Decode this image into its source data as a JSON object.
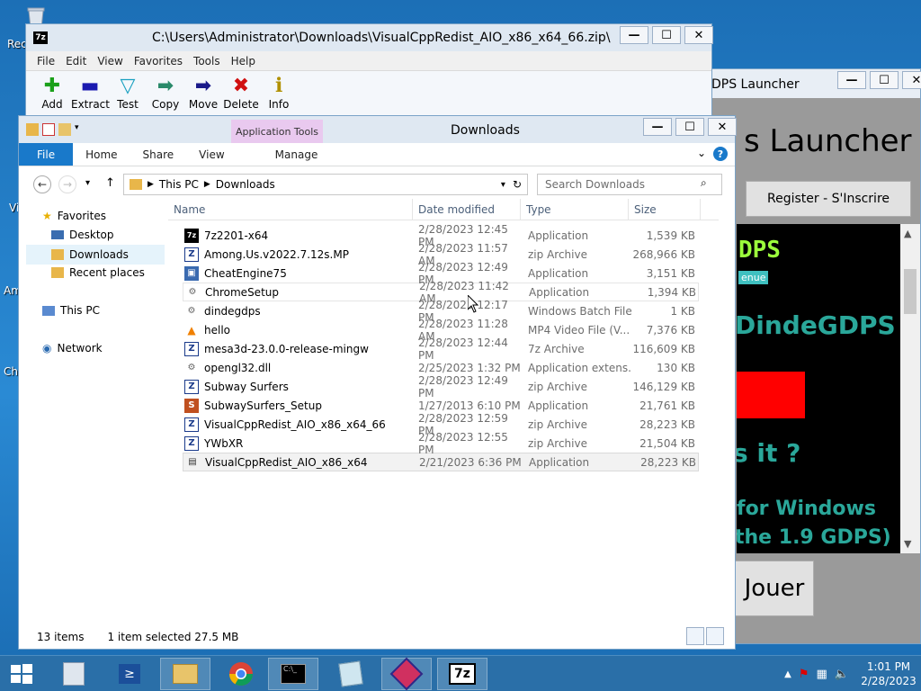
{
  "desktop": {
    "labels": [
      "Rec",
      "Vi",
      "Am",
      "Ch"
    ]
  },
  "launcher": {
    "title": "DPS Launcher",
    "heading": "s Launcher",
    "register_label": "Register - S'Inscrire",
    "logo_text": "DPS",
    "menu_tag": "enue",
    "dinde_text": "DindeGDPS",
    "isit_text": "s it ?",
    "forwin_text": "for Windows",
    "the19_text": "the 1.9 GDPS)",
    "play_label": "Jouer"
  },
  "zip": {
    "title": "C:\\Users\\Administrator\\Downloads\\VisualCppRedist_AIO_x86_x64_66.zip\\",
    "app_icon": "7z",
    "menu": [
      "File",
      "Edit",
      "View",
      "Favorites",
      "Tools",
      "Help"
    ],
    "tools": [
      {
        "label": "Add",
        "icon": "+",
        "color": "#1aa01a"
      },
      {
        "label": "Extract",
        "icon": "−",
        "color": "#1a1ab0"
      },
      {
        "label": "Test",
        "icon": "✓",
        "color": "#1aa0c0"
      },
      {
        "label": "Copy",
        "icon": "➡",
        "color": "#2a8a6a"
      },
      {
        "label": "Move",
        "icon": "➡",
        "color": "#1a1a8a"
      },
      {
        "label": "Delete",
        "icon": "✖",
        "color": "#d01010"
      },
      {
        "label": "Info",
        "icon": "i",
        "color": "#b09000"
      }
    ]
  },
  "explorer": {
    "title": "Downloads",
    "app_tools": "Application Tools",
    "tabs": [
      "File",
      "Home",
      "Share",
      "View",
      "Manage"
    ],
    "address": [
      "This PC",
      "Downloads"
    ],
    "search_placeholder": "Search Downloads",
    "nav": {
      "favorites": "Favorites",
      "desktop": "Desktop",
      "downloads": "Downloads",
      "recent": "Recent places",
      "thispc": "This PC",
      "network": "Network"
    },
    "columns": [
      "Name",
      "Date modified",
      "Type",
      "Size"
    ],
    "files": [
      {
        "name": "7z2201-x64",
        "date": "2/28/2023 12:45 PM",
        "type": "Application",
        "size": "1,539 KB",
        "icon": "7z"
      },
      {
        "name": "Among.Us.v2022.7.12s.MP",
        "date": "2/28/2023 11:57 AM",
        "type": "zip Archive",
        "size": "268,966 KB",
        "icon": "zip"
      },
      {
        "name": "CheatEngine75",
        "date": "2/28/2023 12:49 PM",
        "type": "Application",
        "size": "3,151 KB",
        "icon": "app"
      },
      {
        "name": "ChromeSetup",
        "date": "2/28/2023 11:42 AM",
        "type": "Application",
        "size": "1,394 KB",
        "icon": "app"
      },
      {
        "name": "dindegdps",
        "date": "2/28/2023 12:17 PM",
        "type": "Windows Batch File",
        "size": "1 KB",
        "icon": "bat"
      },
      {
        "name": "hello",
        "date": "2/28/2023 11:28 AM",
        "type": "MP4 Video File (V...",
        "size": "7,376 KB",
        "icon": "vlc"
      },
      {
        "name": "mesa3d-23.0.0-release-mingw",
        "date": "2/28/2023 12:44 PM",
        "type": "7z Archive",
        "size": "116,609 KB",
        "icon": "zip"
      },
      {
        "name": "opengl32.dll",
        "date": "2/25/2023 1:32 PM",
        "type": "Application extens...",
        "size": "130 KB",
        "icon": "dll"
      },
      {
        "name": "Subway Surfers",
        "date": "2/28/2023 12:49 PM",
        "type": "zip Archive",
        "size": "146,129 KB",
        "icon": "zip"
      },
      {
        "name": "SubwaySurfers_Setup",
        "date": "1/27/2013 6:10 PM",
        "type": "Application",
        "size": "21,761 KB",
        "icon": "app"
      },
      {
        "name": "VisualCppRedist_AIO_x86_x64_66",
        "date": "2/28/2023 12:59 PM",
        "type": "zip Archive",
        "size": "28,223 KB",
        "icon": "zip"
      },
      {
        "name": "YWbXR",
        "date": "2/28/2023 12:55 PM",
        "type": "zip Archive",
        "size": "21,504 KB",
        "icon": "zip"
      },
      {
        "name": "VisualCppRedist_AIO_x86_x64",
        "date": "2/21/2023 6:36 PM",
        "type": "Application",
        "size": "28,223 KB",
        "icon": "app"
      }
    ],
    "status_count": "13 items",
    "status_selected": "1 item selected  27.5 MB"
  },
  "taskbar": {
    "clock_time": "1:01 PM",
    "clock_date": "2/28/2023"
  }
}
